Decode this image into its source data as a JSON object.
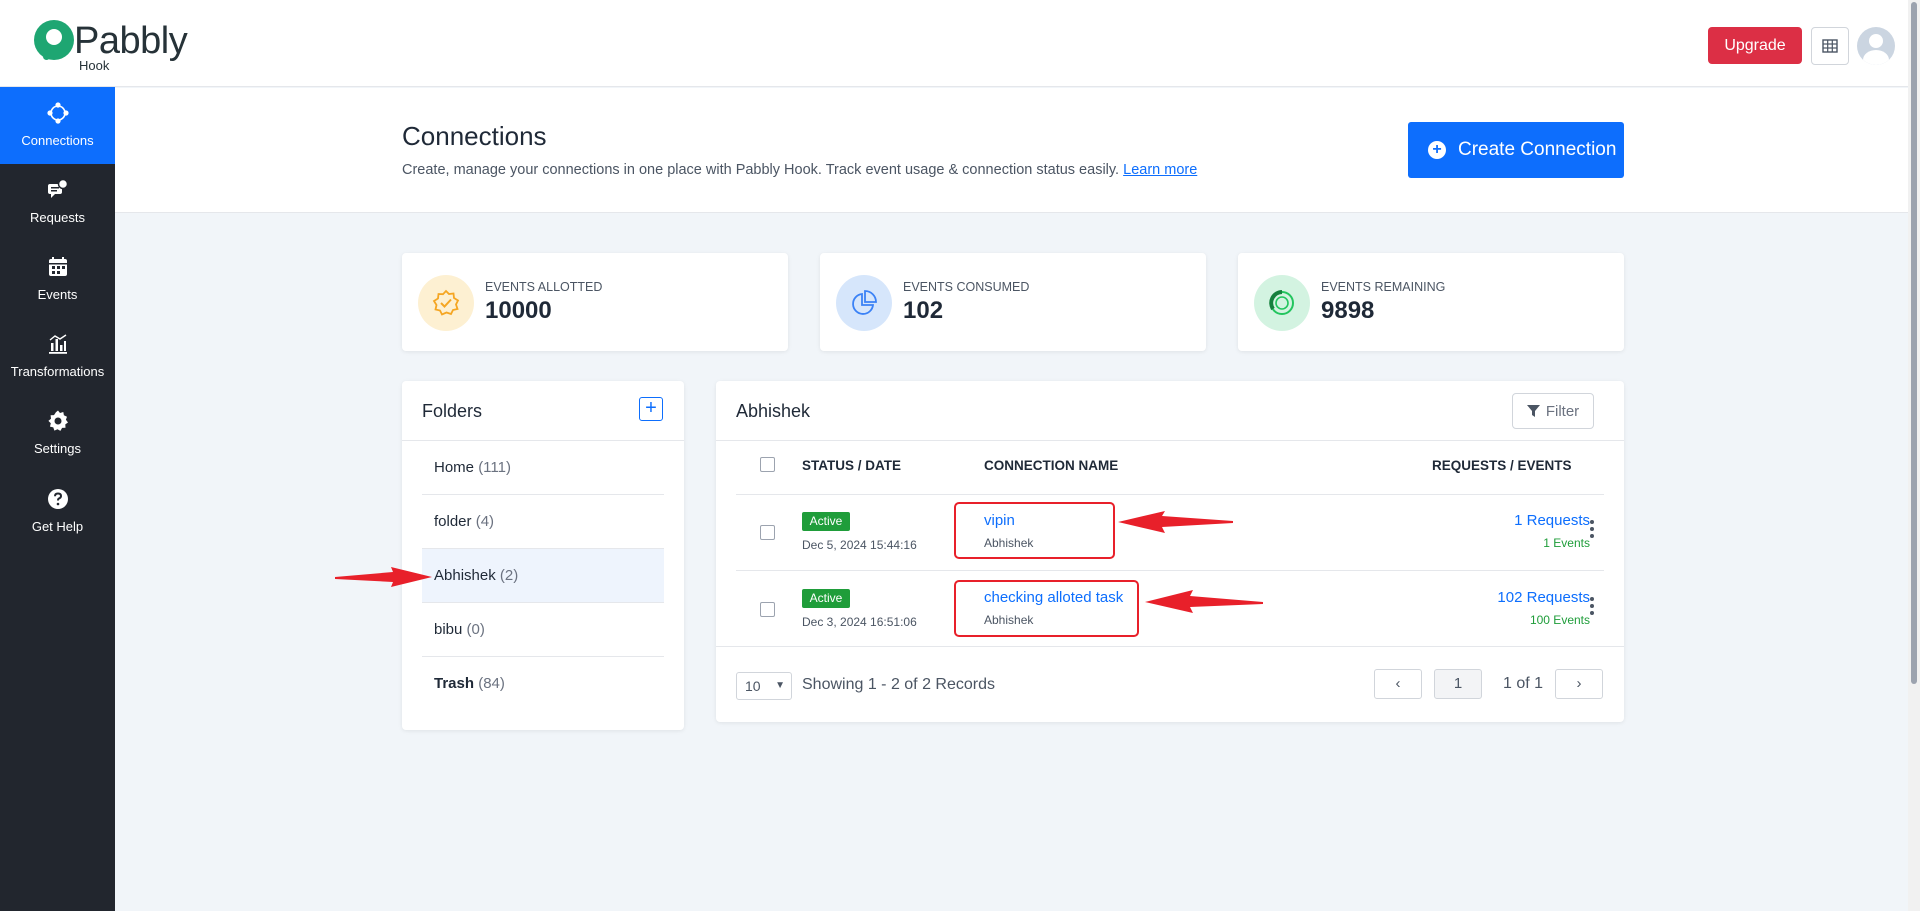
{
  "app": {
    "brand": "Pabbly",
    "product": "Hook"
  },
  "topbar": {
    "upgrade_label": "Upgrade"
  },
  "sidebar": {
    "items": [
      {
        "label": "Connections",
        "icon": "connections-icon",
        "active": true
      },
      {
        "label": "Requests",
        "icon": "requests-icon"
      },
      {
        "label": "Events",
        "icon": "events-icon"
      },
      {
        "label": "Transformations",
        "icon": "transformations-icon"
      },
      {
        "label": "Settings",
        "icon": "settings-icon"
      },
      {
        "label": "Get Help",
        "icon": "help-icon"
      }
    ]
  },
  "header": {
    "title": "Connections",
    "subtitle": "Create, manage your connections in one place with Pabbly Hook. Track event usage & connection status easily.",
    "learn_more": "Learn more",
    "create_label": "Create Connection"
  },
  "stats": [
    {
      "caption": "EVENTS ALLOTTED",
      "value": "10000",
      "icon": "badge-check-icon",
      "color": "#f5a623"
    },
    {
      "caption": "EVENTS CONSUMED",
      "value": "102",
      "icon": "pie-chart-icon",
      "color": "#3b82f6"
    },
    {
      "caption": "EVENTS REMAINING",
      "value": "9898",
      "icon": "donut-icon",
      "color": "#22c55e"
    }
  ],
  "folders": {
    "title": "Folders",
    "items": [
      {
        "name": "Home",
        "count": "(111)"
      },
      {
        "name": "folder",
        "count": "(4)"
      },
      {
        "name": "Abhishek",
        "count": "(2)",
        "selected": true
      },
      {
        "name": "bibu",
        "count": "(0)"
      },
      {
        "name": "Trash",
        "count": "(84)"
      }
    ]
  },
  "table": {
    "title": "Abhishek",
    "filter_label": "Filter",
    "columns": {
      "status": "STATUS / DATE",
      "name": "CONNECTION NAME",
      "requests": "REQUESTS / EVENTS"
    },
    "rows": [
      {
        "status": "Active",
        "date": "Dec 5, 2024 15:44:16",
        "name": "vipin",
        "folder": "Abhishek",
        "requests": "1 Requests",
        "events": "1 Events"
      },
      {
        "status": "Active",
        "date": "Dec 3, 2024 16:51:06",
        "name": "checking alloted task",
        "folder": "Abhishek",
        "requests": "102 Requests",
        "events": "100 Events"
      }
    ],
    "per_page": "10",
    "showing": "Showing 1 - 2 of 2 Records",
    "page": "1",
    "page_of": "1 of 1",
    "prev": "‹",
    "next": "›"
  },
  "colors": {
    "primary": "#0d6efd",
    "sidebar": "#22262e",
    "upgrade": "#dc2f45",
    "active_badge": "#1f9d3a",
    "annotation": "#e8202a"
  }
}
